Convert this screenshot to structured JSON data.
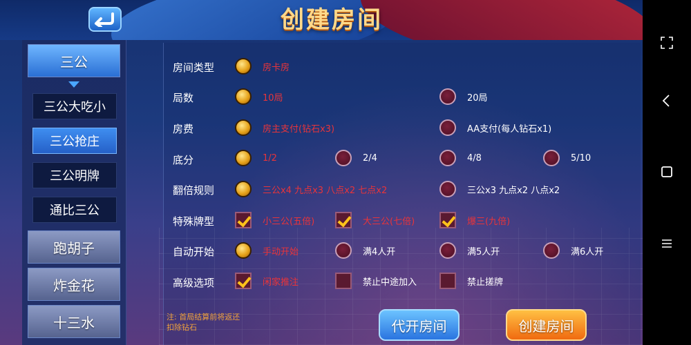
{
  "header": {
    "title": "创建房间"
  },
  "sidebar": {
    "categories": [
      {
        "label": "三公",
        "state": "active"
      },
      {
        "label": "跑胡子",
        "state": "inactive"
      },
      {
        "label": "炸金花",
        "state": "inactive"
      },
      {
        "label": "十三水",
        "state": "inactive"
      }
    ],
    "subitems": [
      {
        "label": "三公大吃小",
        "selected": false
      },
      {
        "label": "三公抢庄",
        "selected": true
      },
      {
        "label": "三公明牌",
        "selected": false
      },
      {
        "label": "通比三公",
        "selected": false
      }
    ]
  },
  "settings": {
    "rows": [
      {
        "label": "房间类型",
        "options": [
          {
            "text": "房卡房",
            "selected": true,
            "type": "radio"
          }
        ]
      },
      {
        "label": "局数",
        "options": [
          {
            "text": "10局",
            "selected": true,
            "type": "radio"
          },
          {
            "text": "20局",
            "selected": false,
            "type": "radio"
          }
        ]
      },
      {
        "label": "房费",
        "options": [
          {
            "text": "房主支付(钻石x3)",
            "selected": true,
            "type": "radio"
          },
          {
            "text": "AA支付(每人钻石x1)",
            "selected": false,
            "type": "radio"
          }
        ]
      },
      {
        "label": "底分",
        "options": [
          {
            "text": "1/2",
            "selected": true,
            "type": "radio"
          },
          {
            "text": "2/4",
            "selected": false,
            "type": "radio"
          },
          {
            "text": "4/8",
            "selected": false,
            "type": "radio"
          },
          {
            "text": "5/10",
            "selected": false,
            "type": "radio"
          }
        ]
      },
      {
        "label": "翻倍规则",
        "options": [
          {
            "text": "三公x4 九点x3 八点x2 七点x2",
            "selected": true,
            "type": "radio"
          },
          {
            "text": "三公x3 九点x2 八点x2",
            "selected": false,
            "type": "radio"
          }
        ]
      },
      {
        "label": "特殊牌型",
        "options": [
          {
            "text": "小三公(五倍)",
            "selected": true,
            "type": "checkbox"
          },
          {
            "text": "大三公(七倍)",
            "selected": true,
            "type": "checkbox"
          },
          {
            "text": "爆三(九倍)",
            "selected": true,
            "type": "checkbox"
          }
        ]
      },
      {
        "label": "自动开始",
        "options": [
          {
            "text": "手动开始",
            "selected": true,
            "type": "radio"
          },
          {
            "text": "满4人开",
            "selected": false,
            "type": "radio"
          },
          {
            "text": "满5人开",
            "selected": false,
            "type": "radio"
          },
          {
            "text": "满6人开",
            "selected": false,
            "type": "radio"
          }
        ]
      },
      {
        "label": "高级选项",
        "options": [
          {
            "text": "闲家推注",
            "selected": true,
            "type": "checkbox"
          },
          {
            "text": "禁止中途加入",
            "selected": false,
            "type": "checkbox"
          },
          {
            "text": "禁止搓牌",
            "selected": false,
            "type": "checkbox"
          }
        ]
      }
    ]
  },
  "footer": {
    "note": "注: 首局结算前将返还扣除钻石",
    "proxy_button": "代开房间",
    "create_button": "创建房间"
  },
  "colors": {
    "selected_text": "#e8343a",
    "accent_blue": "#2a74e0",
    "accent_orange": "#f06a10"
  }
}
